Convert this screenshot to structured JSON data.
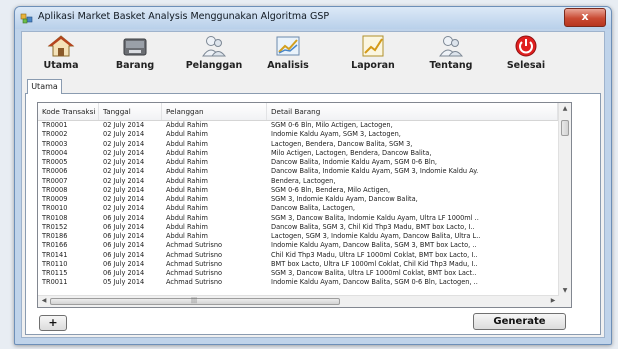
{
  "window": {
    "title": "Aplikasi Market Basket Analysis Menggunakan Algoritma GSP",
    "close_label": "x"
  },
  "toolbar": {
    "items": [
      {
        "label": "Utama",
        "icon": "home-icon"
      },
      {
        "label": "Barang",
        "icon": "box-icon"
      },
      {
        "label": "Pelanggan",
        "icon": "users-icon"
      },
      {
        "label": "Analisis",
        "icon": "chart-icon"
      },
      {
        "label": "Laporan",
        "icon": "report-icon"
      },
      {
        "label": "Tentang",
        "icon": "about-users-icon"
      },
      {
        "label": "Selesai",
        "icon": "power-icon"
      }
    ]
  },
  "tab": {
    "label": "Utama"
  },
  "grid": {
    "columns": [
      "Kode Transaksi",
      "Tanggal",
      "Pelanggan",
      "Detail Barang"
    ],
    "rows": [
      [
        "TR0001",
        "02 July 2014",
        "Abdul Rahim",
        "SGM 0-6 Bln, Milo Actigen, Lactogen,"
      ],
      [
        "TR0002",
        "02 July 2014",
        "Abdul Rahim",
        "Indomie Kaldu Ayam, SGM 3, Lactogen,"
      ],
      [
        "TR0003",
        "02 July 2014",
        "Abdul Rahim",
        "Lactogen, Bendera, Dancow Balita, SGM 3,"
      ],
      [
        "TR0004",
        "02 July 2014",
        "Abdul Rahim",
        "Milo Actigen, Lactogen, Bendera, Dancow Balita,"
      ],
      [
        "TR0005",
        "02 July 2014",
        "Abdul Rahim",
        "Dancow Balita, Indomie Kaldu Ayam, SGM 0-6 Bln,"
      ],
      [
        "TR0006",
        "02 July 2014",
        "Abdul Rahim",
        "Dancow Balita, Indomie Kaldu Ayam, SGM 3, Indomie Kaldu Ay."
      ],
      [
        "TR0007",
        "02 July 2014",
        "Abdul Rahim",
        "Bendera, Lactogen,"
      ],
      [
        "TR0008",
        "02 July 2014",
        "Abdul Rahim",
        "SGM 0-6 Bln, Bendera, Milo Actigen,"
      ],
      [
        "TR0009",
        "02 July 2014",
        "Abdul Rahim",
        "SGM 3, Indomie Kaldu Ayam, Dancow Balita,"
      ],
      [
        "TR0010",
        "02 July 2014",
        "Abdul Rahim",
        "Dancow Balita, Lactogen,"
      ],
      [
        "TR0108",
        "06 July 2014",
        "Abdul Rahim",
        "SGM 3, Dancow Balita, Indomie Kaldu Ayam, Ultra LF 1000ml .."
      ],
      [
        "TR0152",
        "06 July 2014",
        "Abdul Rahim",
        "Dancow Balita, SGM 3, Chil Kid Thp3 Madu, BMT box Lacto, I.."
      ],
      [
        "TR0186",
        "06 July 2014",
        "Abdul Rahim",
        "Lactogen, SGM 3, Indomie Kaldu Ayam, Dancow Balita, Ultra L.."
      ],
      [
        "TR0166",
        "06 July 2014",
        "Achmad Sutrisno",
        "Indomie Kaldu Ayam, Dancow Balita, SGM 3, BMT box Lacto, .."
      ],
      [
        "TR0141",
        "06 July 2014",
        "Achmad Sutrisno",
        "Chil Kid Thp3 Madu, Ultra LF 1000ml Coklat, BMT box Lacto, I.."
      ],
      [
        "TR0110",
        "06 July 2014",
        "Achmad Sutrisno",
        "BMT box Lacto, Ultra LF 1000ml Coklat, Chil Kid Thp3 Madu, I.."
      ],
      [
        "TR0115",
        "06 July 2014",
        "Achmad Sutrisno",
        "SGM 3, Dancow Balita, Ultra LF 1000ml Coklat, BMT box Lact.."
      ],
      [
        "TR0011",
        "05 July 2014",
        "Achmad Sutrisno",
        "Indomie Kaldu Ayam, Dancow Balita, SGM 0-6 Bln, Lactogen, .."
      ]
    ]
  },
  "buttons": {
    "add_label": "+",
    "generate_label": "Generate"
  },
  "colors": {
    "power": "#e02020",
    "titlebar": "#c9dcf1",
    "close": "#c94a33"
  }
}
